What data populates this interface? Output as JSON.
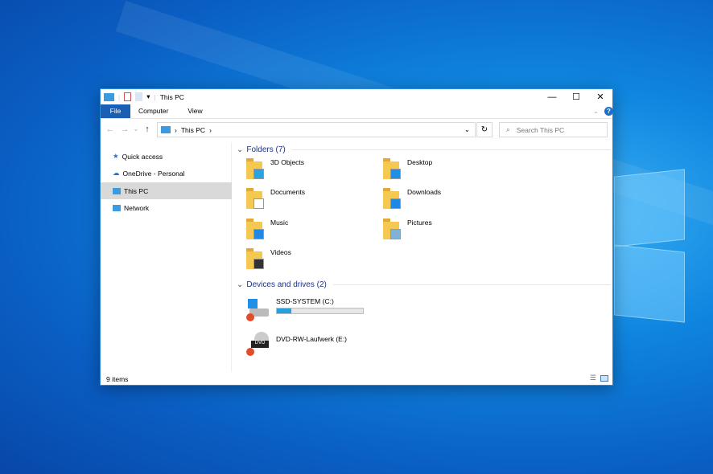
{
  "window": {
    "title": "This PC",
    "controls": {
      "minimize": "—",
      "maximize": "☐",
      "close": "✕"
    }
  },
  "ribbon": {
    "tabs": [
      "File",
      "Computer",
      "View"
    ],
    "help": "?"
  },
  "address": {
    "path": "This PC",
    "search_placeholder": "Search This PC"
  },
  "sidebar": {
    "items": [
      {
        "label": "Quick access",
        "icon": "star-icon"
      },
      {
        "label": "OneDrive - Personal",
        "icon": "cloud-icon"
      },
      {
        "label": "This PC",
        "icon": "computer-icon",
        "selected": true
      },
      {
        "label": "Network",
        "icon": "network-icon"
      }
    ]
  },
  "folders": {
    "header": "Folders (7)",
    "items": [
      "3D Objects",
      "Desktop",
      "Documents",
      "Downloads",
      "Music",
      "Pictures",
      "Videos"
    ]
  },
  "drives": {
    "header": "Devices and drives (2)",
    "items": [
      {
        "label": "SSD-SYSTEM (C:)",
        "used_fraction": 0.17
      },
      {
        "label": "DVD-RW-Laufwerk (E:)"
      }
    ]
  },
  "status": {
    "count": "9 items"
  },
  "colors": {
    "accent": "#1a5fb4",
    "bar": "#26a0da",
    "folder": "#f5c852"
  }
}
